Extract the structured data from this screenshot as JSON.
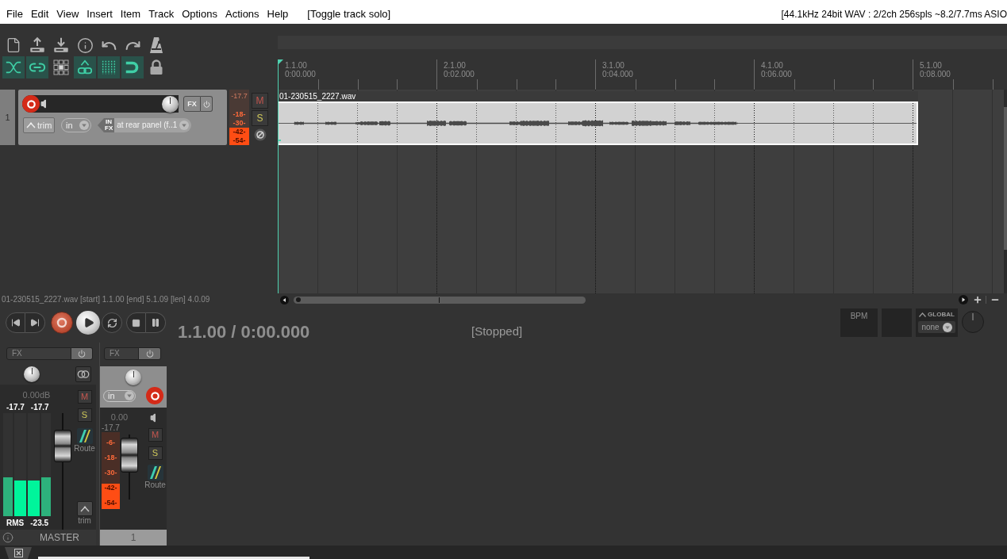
{
  "menu_bar": {
    "items": [
      "File",
      "Edit",
      "View",
      "Insert",
      "Item",
      "Track",
      "Options",
      "Actions",
      "Help"
    ],
    "last_action": "[Toggle track solo]",
    "audio_status": "[44.1kHz 24bit WAV : 2/2ch 256spls ~8.2/7.7ms ASIO"
  },
  "toolbar": {
    "toggles": [
      {
        "on": true
      },
      {
        "on": true
      },
      {
        "on": false
      },
      {
        "on": true
      },
      {
        "on": true
      },
      {
        "on": true
      },
      {
        "on": false
      }
    ]
  },
  "track": {
    "number": "1",
    "armed": true,
    "fx": "FX",
    "automation_mode": "trim",
    "input": "in",
    "input_fx": [
      "IN",
      "FX"
    ],
    "input_device": "at rear panel (f..1",
    "peak": "-17.7",
    "meter_marks": [
      "-18-",
      "-30-",
      "-42-",
      "-54-"
    ],
    "level": 0.31,
    "mute": "M",
    "solo": "S"
  },
  "ruler": {
    "marks": [
      {
        "bar": "1.1.00",
        "time": "0:00.000"
      },
      {
        "bar": "2.1.00",
        "time": "0:02.000"
      },
      {
        "bar": "3.1.00",
        "time": "0:04.000"
      },
      {
        "bar": "4.1.00",
        "time": "0:06.000"
      },
      {
        "bar": "5.1.00",
        "time": "0:08.000"
      }
    ]
  },
  "item": {
    "name": "01-230515_2227.wav"
  },
  "item_info": "01-230515_2227.wav [start] 1.1.00 [end] 5.1.09 [len] 4.0.09",
  "transport": {
    "position": "1.1.00 / 0:00.000",
    "state": "[Stopped]"
  },
  "tempo": {
    "label": "BPM",
    "automation": "GLOBAL",
    "mode": "none"
  },
  "mixer": {
    "master": {
      "fx": "FX",
      "volume": "0.00dB",
      "peaks": [
        "-17.7",
        "-17.7"
      ],
      "mute": "M",
      "solo": "S",
      "route": "Route",
      "meters": [
        {
          "level": 0.38
        },
        {
          "level": 0.35
        },
        {
          "level": 0.35
        },
        {
          "level": 0.38
        }
      ],
      "fader": {
        "level": 0.8
      },
      "rms_label": "RMS",
      "rms": "-23.5",
      "trim": "trim",
      "name": "MASTER"
    },
    "tracks": [
      {
        "fx": "FX",
        "input": "in",
        "armed": true,
        "volume": "0.00",
        "peak": "-17.7",
        "meter_marks": [
          "-6-",
          "-18-",
          "-30-",
          "-42-",
          "-54-"
        ],
        "level": 0.33,
        "fader": {
          "level": 0.9
        },
        "mute": "M",
        "solo": "S",
        "route": "Route",
        "name": "1"
      }
    ]
  }
}
